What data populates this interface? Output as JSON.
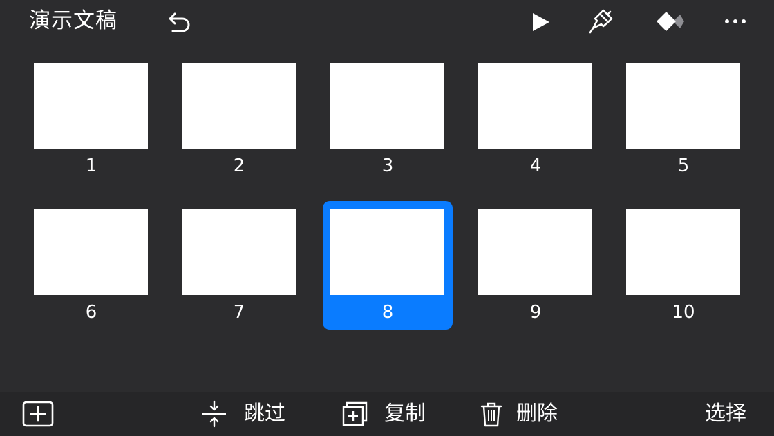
{
  "header": {
    "title": "演示文稿",
    "icons": [
      "undo-icon",
      "play-icon",
      "format-brush-icon",
      "animate-icon",
      "more-icon"
    ]
  },
  "slides": [
    {
      "number": "1",
      "selected": false
    },
    {
      "number": "2",
      "selected": false
    },
    {
      "number": "3",
      "selected": false
    },
    {
      "number": "4",
      "selected": false
    },
    {
      "number": "5",
      "selected": false
    },
    {
      "number": "6",
      "selected": false
    },
    {
      "number": "7",
      "selected": false
    },
    {
      "number": "8",
      "selected": true
    },
    {
      "number": "9",
      "selected": false
    },
    {
      "number": "10",
      "selected": false
    }
  ],
  "toolbar": {
    "add_icon": "plus-square-icon",
    "skip_label": "跳过",
    "copy_label": "复制",
    "delete_label": "删除",
    "select_label": "选择"
  },
  "colors": {
    "background": "#2c2c2e",
    "toolbar_background": "#262628",
    "accent": "#0a7cff",
    "thumbnail": "#ffffff"
  }
}
